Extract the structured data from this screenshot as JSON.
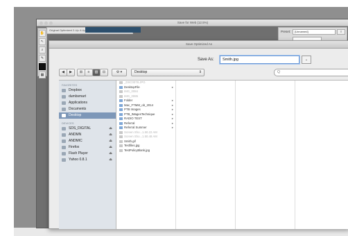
{
  "back_window": {
    "title": "Save for Web (12.5%)",
    "tabs_text": "Original  Optimized  2-Up  4-Up",
    "preset_label": "Preset:",
    "preset_value": "[Unnamed]"
  },
  "tools": [
    "hand-tool",
    "slice-select-tool",
    "zoom-tool",
    "eyedropper-tool",
    "eyedropper-color",
    "toggle-slices"
  ],
  "sheet": {
    "title": "Save Optimized As",
    "save_as_label": "Save As:",
    "filename": "Smith.jpg",
    "location": "Desktop",
    "search_placeholder": "Q",
    "view_buttons": [
      "◀",
      "▶",
      "≡",
      "▥",
      "⊞",
      "⊟",
      "⚙"
    ],
    "share_glyph": "▾"
  },
  "sidebar": {
    "sections": [
      {
        "header": "FAVORITES",
        "items": [
          {
            "label": "Dropbox",
            "eject": false,
            "selected": false
          },
          {
            "label": "dumbsmart",
            "eject": false,
            "selected": false
          },
          {
            "label": "Applications",
            "eject": false,
            "selected": false
          },
          {
            "label": "Documents",
            "eject": false,
            "selected": false
          },
          {
            "label": "Desktop",
            "eject": false,
            "selected": true
          }
        ]
      },
      {
        "header": "DEVICES",
        "items": [
          {
            "label": "SDS_DIGITAL",
            "eject": true,
            "selected": false
          },
          {
            "label": "ANDMN",
            "eject": true,
            "selected": false
          },
          {
            "label": "ANDMIC",
            "eject": true,
            "selected": false
          },
          {
            "label": "Firefox",
            "eject": true,
            "selected": false
          },
          {
            "label": "Flash Player",
            "eject": true,
            "selected": false
          },
          {
            "label": "Yahoo 0.8.1",
            "eject": true,
            "selected": false
          }
        ]
      }
    ]
  },
  "files": [
    {
      "name": "_DSC0078.JPG",
      "dim": true,
      "folder": false,
      "arrow": false
    },
    {
      "name": "DesktopFile",
      "dim": false,
      "folder": true,
      "arrow": true
    },
    {
      "name": "IMG_0084",
      "dim": true,
      "folder": false,
      "arrow": false
    },
    {
      "name": "IMG_0085",
      "dim": true,
      "folder": false,
      "arrow": false
    },
    {
      "name": "Folder",
      "dim": false,
      "folder": true,
      "arrow": true
    },
    {
      "name": "Mac_FTMM_ob_2014",
      "dim": false,
      "folder": true,
      "arrow": true
    },
    {
      "name": "PTB Images",
      "dim": false,
      "folder": true,
      "arrow": true
    },
    {
      "name": "PTB_IMagesTechnique",
      "dim": false,
      "folder": true,
      "arrow": true
    },
    {
      "name": "RADIO TEST",
      "dim": false,
      "folder": true,
      "arrow": true
    },
    {
      "name": "Referral",
      "dim": false,
      "folder": true,
      "arrow": true
    },
    {
      "name": "Referral Summer",
      "dim": false,
      "folder": true,
      "arrow": true
    },
    {
      "name": "Screen Sho...1.50.22 AM",
      "dim": true,
      "folder": false,
      "arrow": false
    },
    {
      "name": "Screen Sho...1.50.48 AM",
      "dim": true,
      "folder": false,
      "arrow": false
    },
    {
      "name": "Smith.gif",
      "dim": false,
      "folder": false,
      "arrow": false
    },
    {
      "name": "Testfiles.jpg",
      "dim": false,
      "folder": false,
      "arrow": false
    },
    {
      "name": "TestPolicyBlank.jpg",
      "dim": false,
      "folder": false,
      "arrow": false
    }
  ]
}
